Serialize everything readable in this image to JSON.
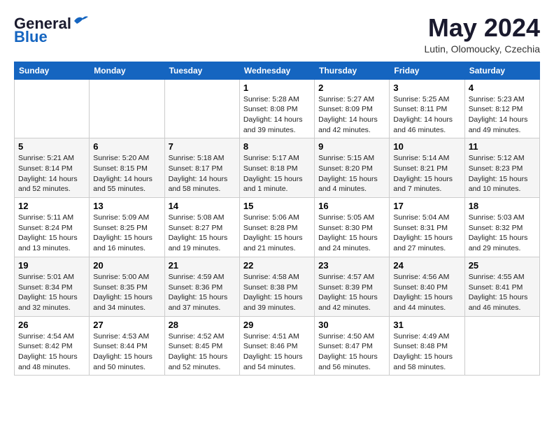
{
  "header": {
    "logo_general": "General",
    "logo_blue": "Blue",
    "month_title": "May 2024",
    "location": "Lutin, Olomoucky, Czechia"
  },
  "calendar": {
    "days_of_week": [
      "Sunday",
      "Monday",
      "Tuesday",
      "Wednesday",
      "Thursday",
      "Friday",
      "Saturday"
    ],
    "weeks": [
      [
        {
          "day": "",
          "info": ""
        },
        {
          "day": "",
          "info": ""
        },
        {
          "day": "",
          "info": ""
        },
        {
          "day": "1",
          "info": "Sunrise: 5:28 AM\nSunset: 8:08 PM\nDaylight: 14 hours\nand 39 minutes."
        },
        {
          "day": "2",
          "info": "Sunrise: 5:27 AM\nSunset: 8:09 PM\nDaylight: 14 hours\nand 42 minutes."
        },
        {
          "day": "3",
          "info": "Sunrise: 5:25 AM\nSunset: 8:11 PM\nDaylight: 14 hours\nand 46 minutes."
        },
        {
          "day": "4",
          "info": "Sunrise: 5:23 AM\nSunset: 8:12 PM\nDaylight: 14 hours\nand 49 minutes."
        }
      ],
      [
        {
          "day": "5",
          "info": "Sunrise: 5:21 AM\nSunset: 8:14 PM\nDaylight: 14 hours\nand 52 minutes."
        },
        {
          "day": "6",
          "info": "Sunrise: 5:20 AM\nSunset: 8:15 PM\nDaylight: 14 hours\nand 55 minutes."
        },
        {
          "day": "7",
          "info": "Sunrise: 5:18 AM\nSunset: 8:17 PM\nDaylight: 14 hours\nand 58 minutes."
        },
        {
          "day": "8",
          "info": "Sunrise: 5:17 AM\nSunset: 8:18 PM\nDaylight: 15 hours\nand 1 minute."
        },
        {
          "day": "9",
          "info": "Sunrise: 5:15 AM\nSunset: 8:20 PM\nDaylight: 15 hours\nand 4 minutes."
        },
        {
          "day": "10",
          "info": "Sunrise: 5:14 AM\nSunset: 8:21 PM\nDaylight: 15 hours\nand 7 minutes."
        },
        {
          "day": "11",
          "info": "Sunrise: 5:12 AM\nSunset: 8:23 PM\nDaylight: 15 hours\nand 10 minutes."
        }
      ],
      [
        {
          "day": "12",
          "info": "Sunrise: 5:11 AM\nSunset: 8:24 PM\nDaylight: 15 hours\nand 13 minutes."
        },
        {
          "day": "13",
          "info": "Sunrise: 5:09 AM\nSunset: 8:25 PM\nDaylight: 15 hours\nand 16 minutes."
        },
        {
          "day": "14",
          "info": "Sunrise: 5:08 AM\nSunset: 8:27 PM\nDaylight: 15 hours\nand 19 minutes."
        },
        {
          "day": "15",
          "info": "Sunrise: 5:06 AM\nSunset: 8:28 PM\nDaylight: 15 hours\nand 21 minutes."
        },
        {
          "day": "16",
          "info": "Sunrise: 5:05 AM\nSunset: 8:30 PM\nDaylight: 15 hours\nand 24 minutes."
        },
        {
          "day": "17",
          "info": "Sunrise: 5:04 AM\nSunset: 8:31 PM\nDaylight: 15 hours\nand 27 minutes."
        },
        {
          "day": "18",
          "info": "Sunrise: 5:03 AM\nSunset: 8:32 PM\nDaylight: 15 hours\nand 29 minutes."
        }
      ],
      [
        {
          "day": "19",
          "info": "Sunrise: 5:01 AM\nSunset: 8:34 PM\nDaylight: 15 hours\nand 32 minutes."
        },
        {
          "day": "20",
          "info": "Sunrise: 5:00 AM\nSunset: 8:35 PM\nDaylight: 15 hours\nand 34 minutes."
        },
        {
          "day": "21",
          "info": "Sunrise: 4:59 AM\nSunset: 8:36 PM\nDaylight: 15 hours\nand 37 minutes."
        },
        {
          "day": "22",
          "info": "Sunrise: 4:58 AM\nSunset: 8:38 PM\nDaylight: 15 hours\nand 39 minutes."
        },
        {
          "day": "23",
          "info": "Sunrise: 4:57 AM\nSunset: 8:39 PM\nDaylight: 15 hours\nand 42 minutes."
        },
        {
          "day": "24",
          "info": "Sunrise: 4:56 AM\nSunset: 8:40 PM\nDaylight: 15 hours\nand 44 minutes."
        },
        {
          "day": "25",
          "info": "Sunrise: 4:55 AM\nSunset: 8:41 PM\nDaylight: 15 hours\nand 46 minutes."
        }
      ],
      [
        {
          "day": "26",
          "info": "Sunrise: 4:54 AM\nSunset: 8:42 PM\nDaylight: 15 hours\nand 48 minutes."
        },
        {
          "day": "27",
          "info": "Sunrise: 4:53 AM\nSunset: 8:44 PM\nDaylight: 15 hours\nand 50 minutes."
        },
        {
          "day": "28",
          "info": "Sunrise: 4:52 AM\nSunset: 8:45 PM\nDaylight: 15 hours\nand 52 minutes."
        },
        {
          "day": "29",
          "info": "Sunrise: 4:51 AM\nSunset: 8:46 PM\nDaylight: 15 hours\nand 54 minutes."
        },
        {
          "day": "30",
          "info": "Sunrise: 4:50 AM\nSunset: 8:47 PM\nDaylight: 15 hours\nand 56 minutes."
        },
        {
          "day": "31",
          "info": "Sunrise: 4:49 AM\nSunset: 8:48 PM\nDaylight: 15 hours\nand 58 minutes."
        },
        {
          "day": "",
          "info": ""
        }
      ]
    ]
  }
}
